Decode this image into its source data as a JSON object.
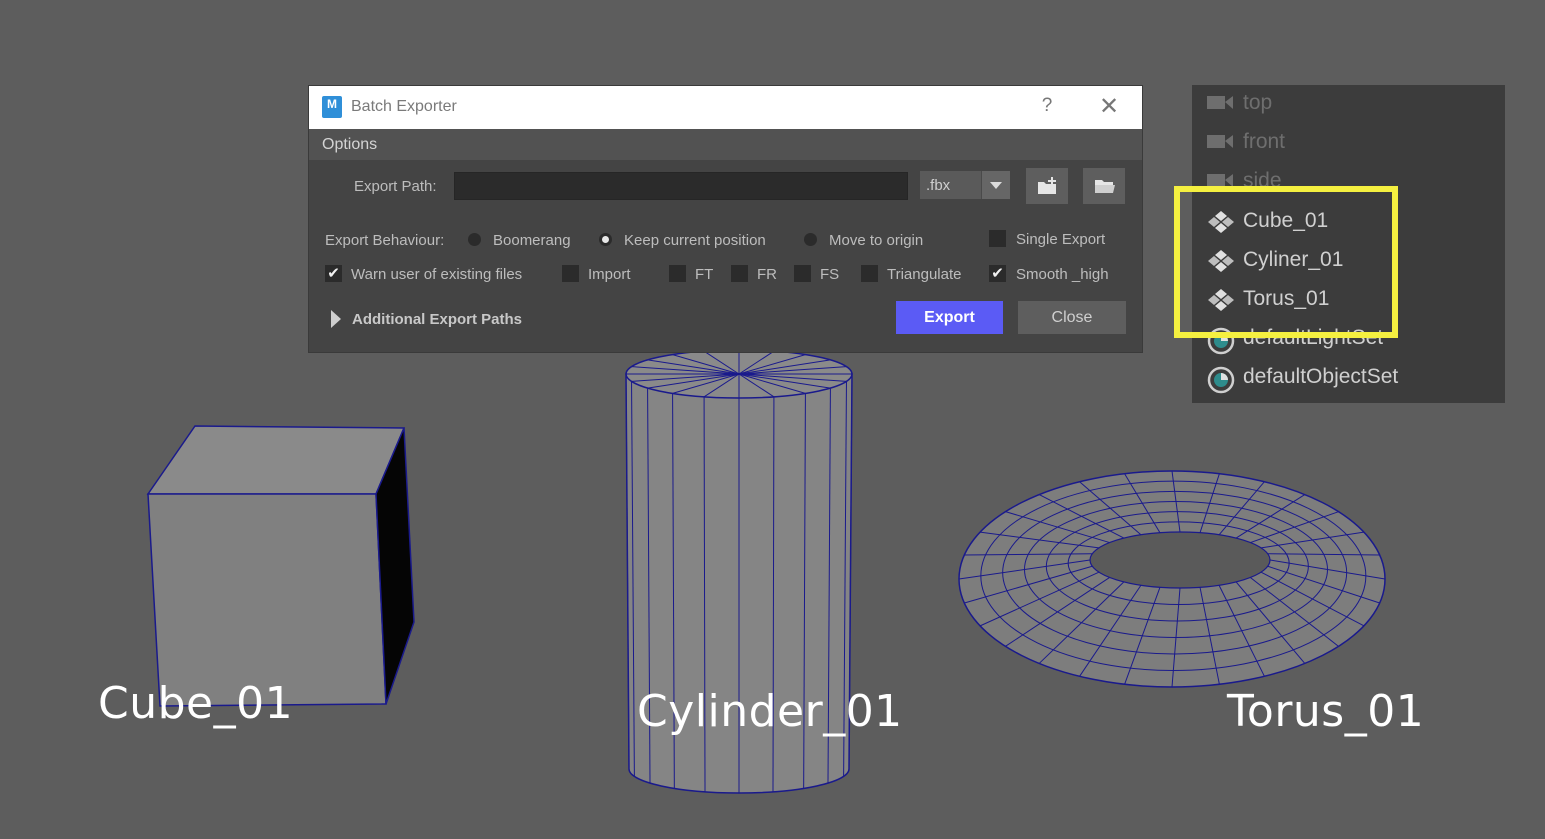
{
  "dialog": {
    "title": "Batch Exporter",
    "help_label": "?",
    "close_label": "✕",
    "options_header": "Options",
    "export_path_label": "Export Path:",
    "export_path_value": "",
    "format_value": ".fbx",
    "export_behaviour_label": "Export Behaviour:",
    "radio_boomerang": "Boomerang",
    "radio_keep_position": "Keep current position",
    "radio_move_to_origin": "Move to origin",
    "selected_behaviour": "Keep current position",
    "cb_single_export": "Single Export",
    "cb_warn_existing": "Warn user of existing files",
    "cb_import": "Import",
    "cb_ft": "FT",
    "cb_fr": "FR",
    "cb_fs": "FS",
    "cb_triangulate": "Triangulate",
    "cb_smooth_high": "Smooth _high",
    "additional_paths": "Additional Export Paths",
    "export_button": "Export",
    "close_button": "Close"
  },
  "outliner": {
    "items": [
      {
        "label": "top",
        "icon": "camera-icon"
      },
      {
        "label": "front",
        "icon": "camera-icon"
      },
      {
        "label": "side",
        "icon": "camera-icon"
      },
      {
        "label": "Cube_01",
        "icon": "mesh-transform-icon"
      },
      {
        "label": "Cyliner_01",
        "icon": "mesh-transform-icon"
      },
      {
        "label": "Torus_01",
        "icon": "mesh-transform-icon"
      },
      {
        "label": "defaultLightSet",
        "icon": "set-icon"
      },
      {
        "label": "defaultObjectSet",
        "icon": "set-icon"
      }
    ]
  },
  "viewport": {
    "labels": {
      "cube": "Cube_01",
      "cylinder": "Cylinder_01",
      "torus": "Torus_01"
    }
  },
  "colors": {
    "background": "#5d5d5d",
    "export_button": "#5b5bf5",
    "highlight": "#f5f040",
    "wireframe": "#1a1a8c"
  }
}
